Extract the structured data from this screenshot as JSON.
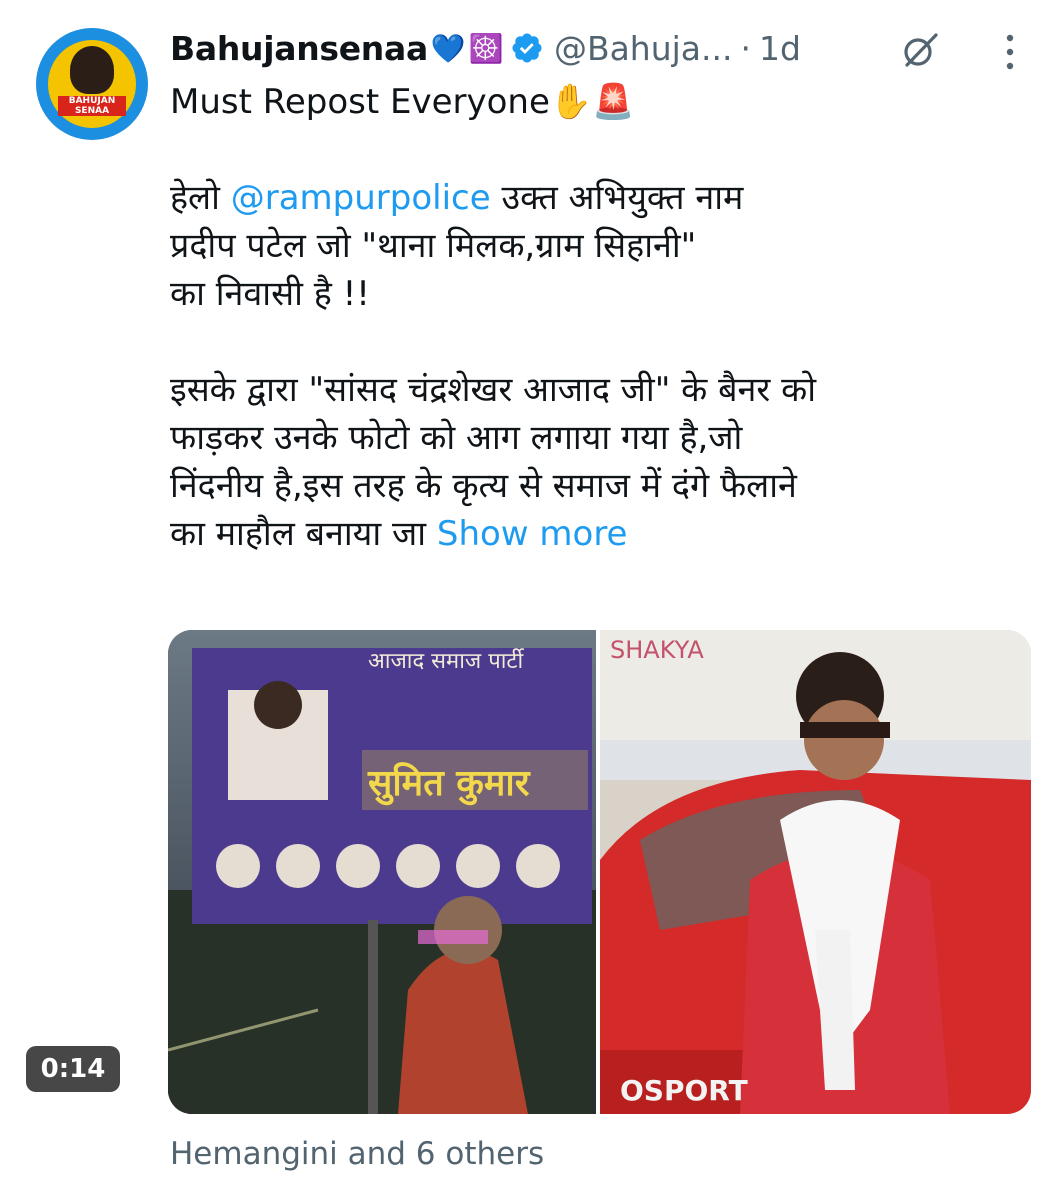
{
  "post": {
    "author": {
      "display_name": "Bahujansenaa",
      "emojis": [
        "💙",
        "☸️"
      ],
      "verified": true,
      "handle": "@Bahuja...",
      "avatar_text": "BAHUJAN SENAA"
    },
    "separator": "·",
    "time": "1d",
    "text": {
      "line1": "Must Repost Everyone✋🚨",
      "para2_line1_pre": "हेलो ",
      "mention": "@rampurpolice",
      "para2_line1_post": " उक्त अभियुक्त नाम",
      "para2_line2": "प्रदीप पटेल जो \"थाना मिलक,ग्राम सिहानी\"",
      "para2_line3": "का निवासी है !!",
      "para3_line1": "इसके द्वारा \"सांसद चंद्रशेखर आजाद जी\" के बैनर को",
      "para3_line2": "फाड़कर उनके फोटो को आग लगाया गया है,जो",
      "para3_line3": "निंदनीय है,इस तरह के कृत्य से समाज में दंगे फैलाने",
      "para3_line4": "का माहौल बनाया जा ",
      "show_more": "Show more"
    },
    "media": {
      "video_duration": "0:14",
      "left_banner_texts": [
        "आजाद समाज पार्टी",
        "सुमित कुमार"
      ],
      "right_sign_text": "SHAKYA",
      "right_car_text": "OSPORT"
    },
    "social_context": "Hemangini and 6 others"
  },
  "colors": {
    "accent": "#1d9bf0",
    "secondary_text": "#536471",
    "primary_text": "#0f1419"
  }
}
